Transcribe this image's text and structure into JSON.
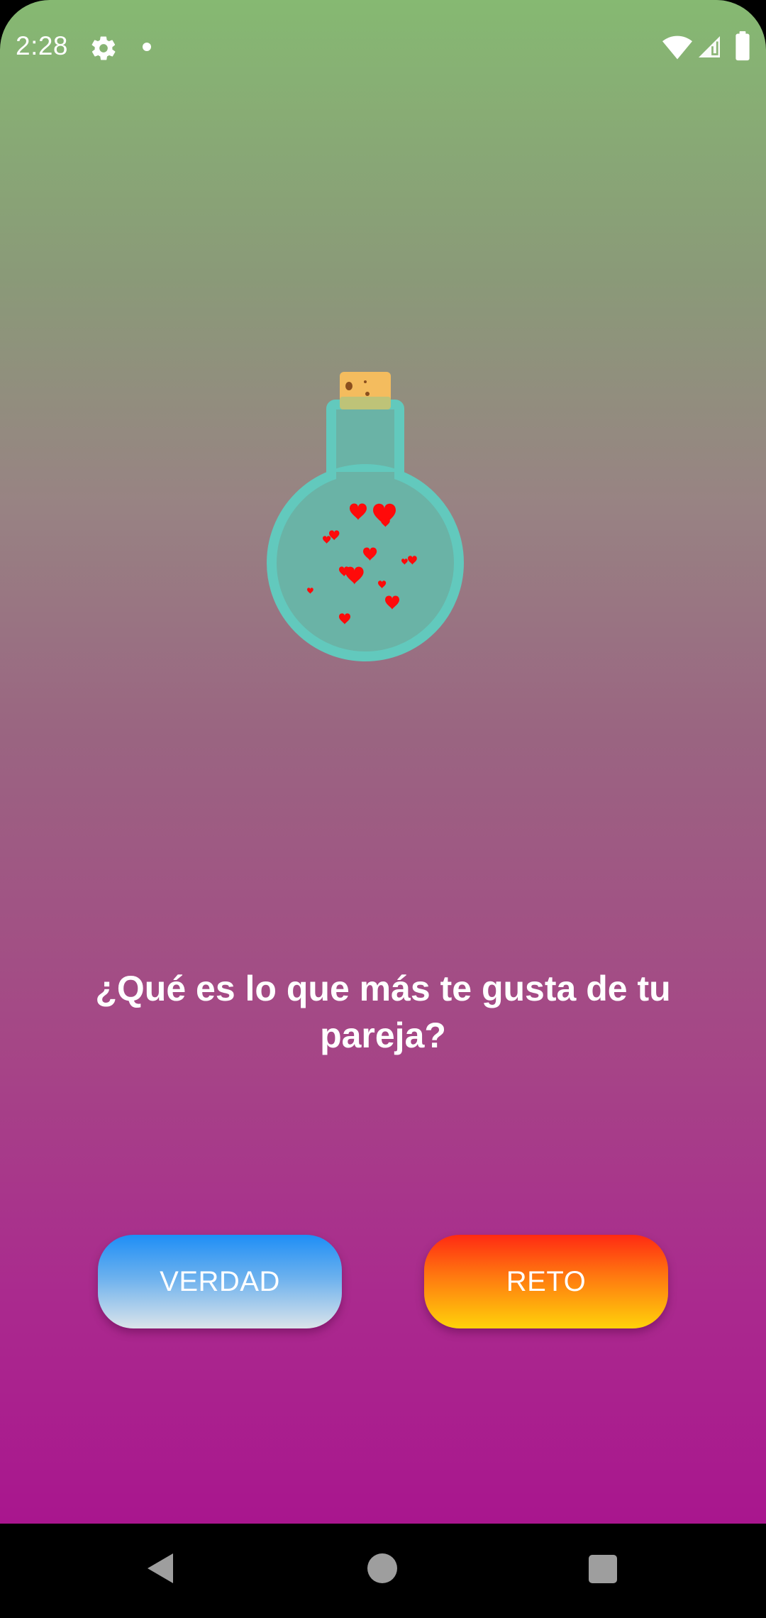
{
  "status_bar": {
    "time": "2:28",
    "icons": [
      "gear-icon",
      "notification-dot-icon",
      "wifi-icon",
      "signal-icon",
      "battery-icon"
    ]
  },
  "illustration": {
    "icon": "love-potion-bottle-icon",
    "colors": {
      "glass": "#62c9bd",
      "liquid": "#6ab3a6",
      "cork": "#f4bc5e",
      "hearts": "#ff0a0a"
    }
  },
  "question": {
    "text": "¿Qué es lo que más te gusta de tu pareja?"
  },
  "buttons": {
    "truth_label": "VERDAD",
    "dare_label": "RETO"
  },
  "nav_bar": {
    "icons": [
      "back-icon",
      "home-icon",
      "recents-icon"
    ]
  },
  "colors": {
    "background_top": "#86b972",
    "background_bottom": "#a9168e",
    "truth_button_top": "#1e8ef6",
    "truth_button_bottom": "#dbe4ea",
    "dare_button_top": "#ff2a12",
    "dare_button_bottom": "#ffd20a"
  }
}
